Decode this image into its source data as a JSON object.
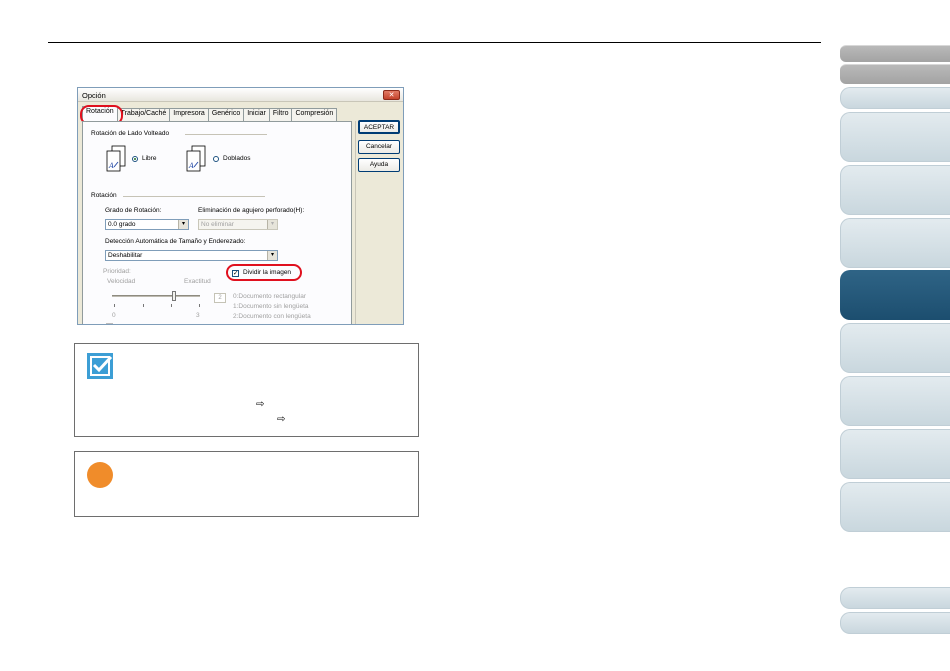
{
  "dialog": {
    "title": "Opción",
    "close_glyph": "✕",
    "tabs": [
      {
        "label": "Rotación",
        "active": true
      },
      {
        "label": "Trabajo/Caché",
        "active": false
      },
      {
        "label": "Impresora",
        "active": false
      },
      {
        "label": "Genérico",
        "active": false
      },
      {
        "label": "Iniciar",
        "active": false
      },
      {
        "label": "Filtro",
        "active": false
      },
      {
        "label": "Compresión",
        "active": false
      }
    ],
    "buttons": {
      "ok": "ACEPTAR",
      "cancel": "Cancelar",
      "help": "Ayuda"
    },
    "flip_group": {
      "title": "Rotación de Lado Volteado",
      "option_free": "Libre",
      "option_folded": "Doblados"
    },
    "rotation_group": {
      "title": "Rotación",
      "degree_label": "Grado de Rotación:",
      "degree_value": "0.0 grado",
      "punch_label": "Eliminación de agujero perforado(H):",
      "punch_value": "No eliminar",
      "autodetect_label": "Detección Automática de Tamaño y Enderezado:",
      "autodetect_value": "Deshabilitar",
      "split_image_label": "Dividir la imagen",
      "split_image_checked": true,
      "priority_label": "Prioridad:",
      "speed_label": "Velocidad",
      "accuracy_label": "Exactitud",
      "slider_min": "0",
      "slider_max": "3",
      "spin_value": "2",
      "doc_types": [
        "0:Documento rectangular",
        "1:Documento sin lengüeta",
        "2:Documento con lengüeta"
      ]
    }
  },
  "glyphs": {
    "check": "✓",
    "dropdown": "▾",
    "arrow_ref": "⇨"
  },
  "colors": {
    "highlight": "#e0101e",
    "nav_active": "#1c4e6f",
    "hint_icon": "#3c9ed5",
    "attention_icon": "#f08c2a"
  }
}
